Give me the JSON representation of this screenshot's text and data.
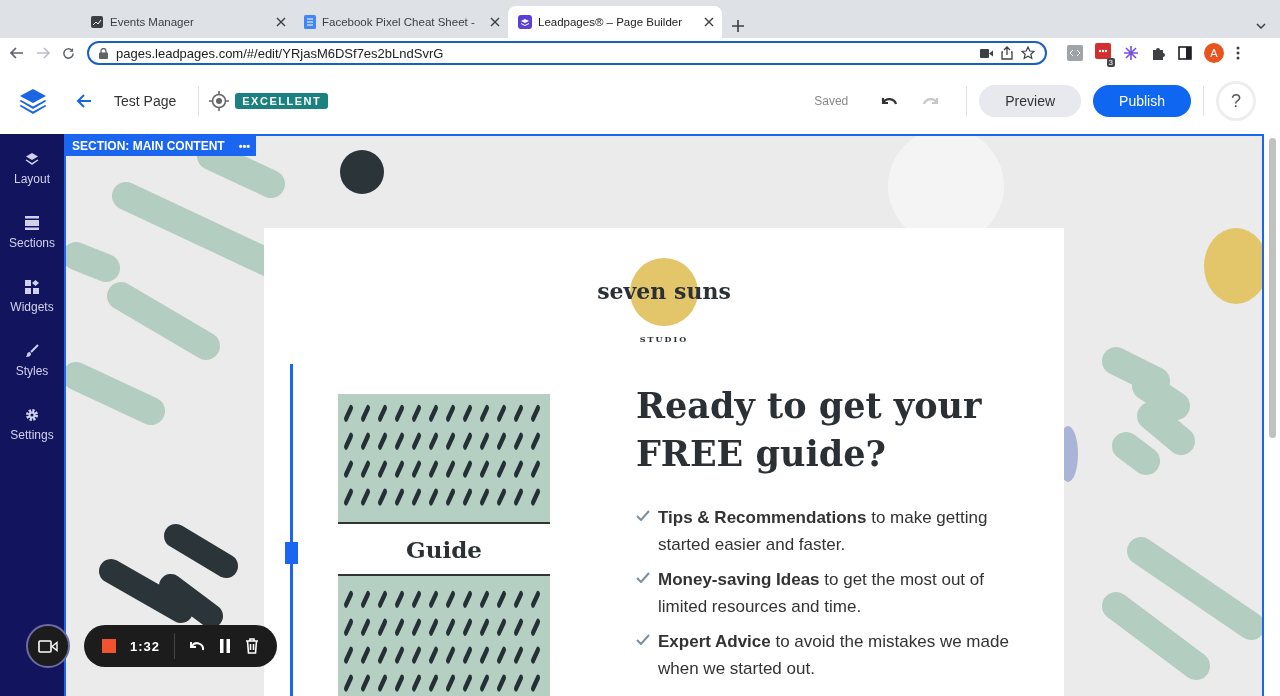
{
  "browser": {
    "tabs": [
      {
        "title": "Events Manager",
        "selected": false
      },
      {
        "title": "Facebook Pixel Cheat Sheet -",
        "selected": false
      },
      {
        "title": "Leadpages® – Page Builder",
        "selected": true
      }
    ],
    "url": "pages.leadpages.com/#/edit/YRjasM6DSf7es2bLndSvrG",
    "extension_badge": "3",
    "profile_initial": "A"
  },
  "header": {
    "page_title": "Test Page",
    "score_badge": "EXCELLENT",
    "save_status": "Saved",
    "undo": {
      "disabled": false
    },
    "redo": {
      "disabled": true
    },
    "buttons": [
      "Preview",
      "Publish"
    ],
    "help": "?"
  },
  "sidebar": {
    "items": [
      {
        "label": "Layout"
      },
      {
        "label": "Sections"
      },
      {
        "label": "Widgets"
      },
      {
        "label": "Styles"
      },
      {
        "label": "Settings"
      }
    ]
  },
  "canvas": {
    "section_label": "SECTION: MAIN CONTENT",
    "section_menu": "•••",
    "logo": {
      "name": "seven suns",
      "tagline": "STUDIO"
    },
    "cover_title": "Guide",
    "heading": "Ready to get your FREE guide?",
    "bullets": [
      "**Tips & Recommendations** to make getting started easier and faster.",
      "**Money-saving Ideas** to get the most out of limited resources and time.",
      "**Expert Advice** to avoid the mistakes we made when we started out."
    ]
  },
  "recorder": {
    "time": "1:32"
  }
}
